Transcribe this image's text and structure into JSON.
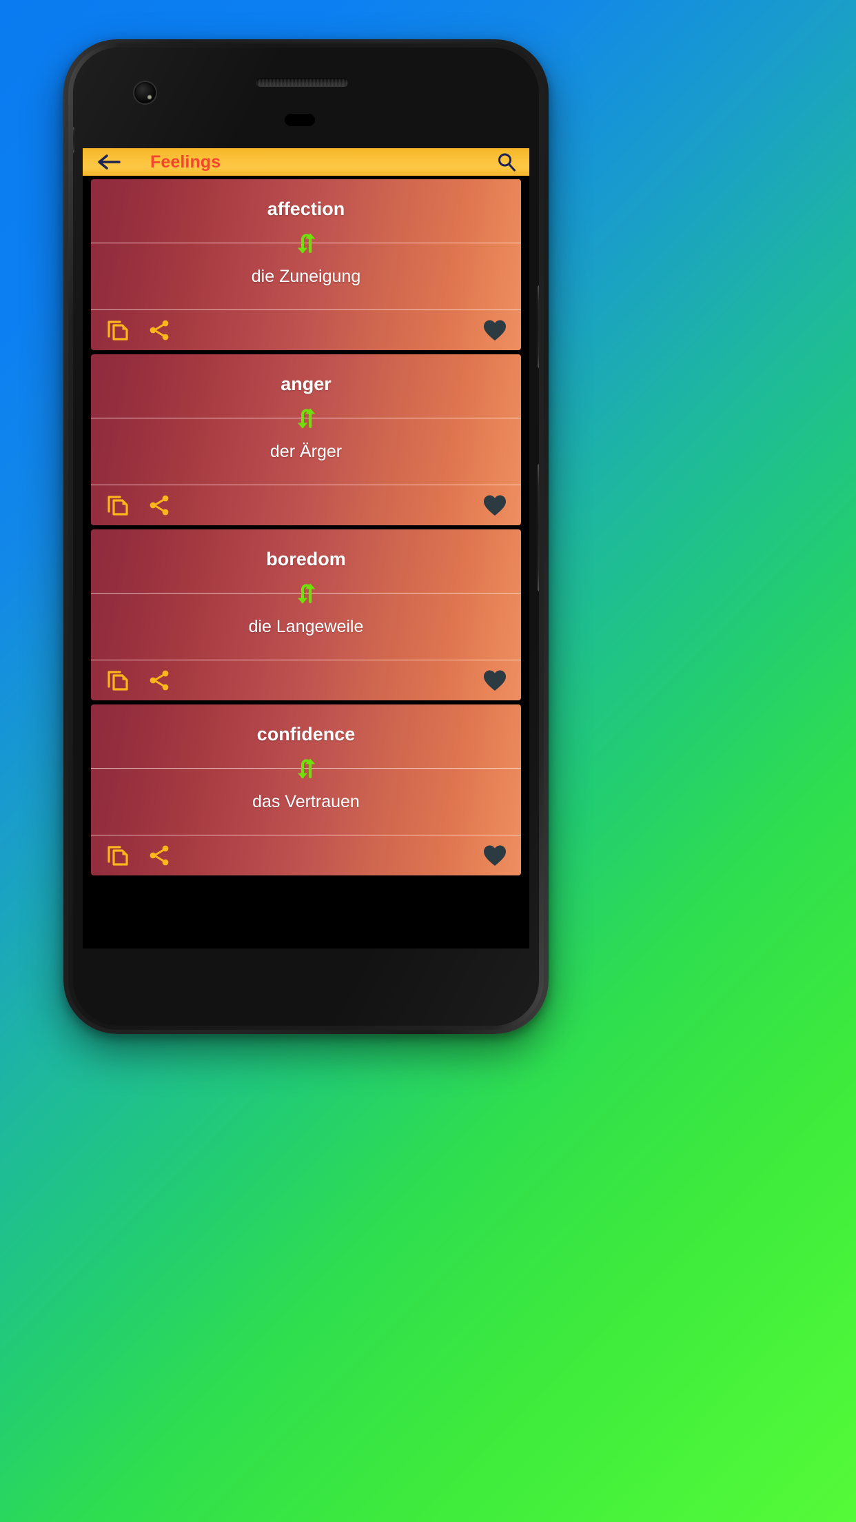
{
  "background": {
    "gradient_from": "#0A7BF0",
    "gradient_to": "#55FA38"
  },
  "device": {
    "frame_color": "#1d1d1d",
    "screen_background": "#000000"
  },
  "appbar": {
    "title": "Feelings",
    "title_color": "#F4462E",
    "background_color": "#FBC13A",
    "back_icon": "arrow-left-icon",
    "search_icon": "search-icon",
    "icon_color": "#1C2355"
  },
  "theme": {
    "card_gradient_from": "#8E2B3E",
    "card_gradient_to": "#EE8F60",
    "swap_icon_color": "#6FE00A",
    "action_icon_color": "#FDB61C",
    "favorite_icon_color": "#2C3A42",
    "text_color": "#FFFFFF"
  },
  "list": {
    "cards": [
      {
        "term": "affection",
        "translation": "die Zuneigung",
        "swap_icon": "swap-vertical-icon",
        "copy_icon": "copy-icon",
        "share_icon": "share-icon",
        "favorite_icon": "heart-filled-icon"
      },
      {
        "term": "anger",
        "translation": "der Ärger",
        "swap_icon": "swap-vertical-icon",
        "copy_icon": "copy-icon",
        "share_icon": "share-icon",
        "favorite_icon": "heart-filled-icon"
      },
      {
        "term": "boredom",
        "translation": "die Langeweile",
        "swap_icon": "swap-vertical-icon",
        "copy_icon": "copy-icon",
        "share_icon": "share-icon",
        "favorite_icon": "heart-filled-icon"
      },
      {
        "term": "confidence",
        "translation": "das Vertrauen",
        "swap_icon": "swap-vertical-icon",
        "copy_icon": "copy-icon",
        "share_icon": "share-icon",
        "favorite_icon": "heart-filled-icon"
      }
    ]
  }
}
